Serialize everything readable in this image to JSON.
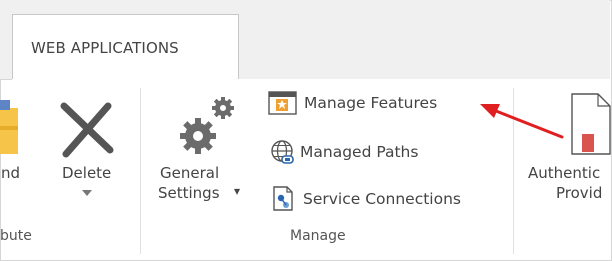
{
  "tabs": [
    {
      "label": "WEB APPLICATIONS"
    }
  ],
  "left_partial": {
    "button_label": "nd",
    "group_label": "bute"
  },
  "delete_button": {
    "label": "Delete"
  },
  "general_settings": {
    "label_line1": "General",
    "label_line2": "Settings",
    "dropdown_glyph": "▾"
  },
  "manage_group": {
    "items": [
      {
        "label": "Manage Features",
        "icon": "manage-features-icon"
      },
      {
        "label": "Managed Paths",
        "icon": "globe-icon"
      },
      {
        "label": "Service Connections",
        "icon": "service-connections-icon"
      }
    ],
    "group_label": "Manage"
  },
  "authentication": {
    "label_line1": "Authentic",
    "label_line2": "Provid"
  },
  "annotation": {
    "color": "#e02020"
  },
  "colors": {
    "accent_orange": "#f0a030",
    "folder_yellow": "#f5c449",
    "icon_gray": "#6b6b6b",
    "globe_blue": "#2a66b0"
  }
}
